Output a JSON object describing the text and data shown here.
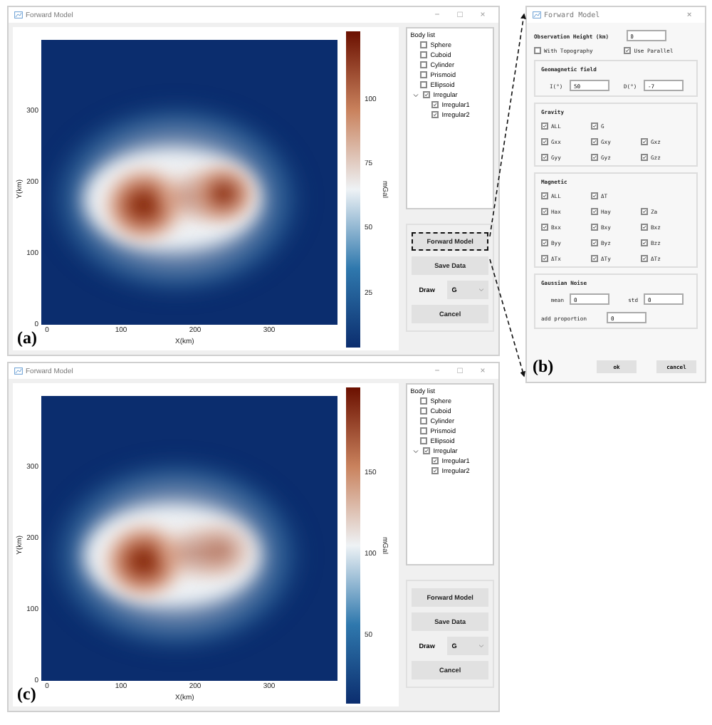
{
  "windows": [
    {
      "panel_label": "(a)",
      "title": "Forward Model",
      "controls": [
        "−",
        "□",
        "×"
      ],
      "plot": {
        "yticks": [
          "300",
          "200",
          "100",
          "0"
        ],
        "xticks": [
          "0",
          "100",
          "200",
          "300"
        ],
        "xlabel": "X(km)",
        "ylabel": "Y(km)",
        "colorbar_ticks": [
          "100",
          "75",
          "50",
          "25"
        ],
        "colorbar_label": "mGal"
      },
      "body_list": {
        "title": "Body list",
        "items": [
          {
            "label": "Sphere",
            "checked": false
          },
          {
            "label": "Cuboid",
            "checked": false
          },
          {
            "label": "Cylinder",
            "checked": false
          },
          {
            "label": "Prismoid",
            "checked": false
          },
          {
            "label": "Ellipsoid",
            "checked": false
          },
          {
            "label": "Irregular",
            "checked": true,
            "expanded": true,
            "children": [
              {
                "label": "Irregular1",
                "checked": true
              },
              {
                "label": "Irregular2",
                "checked": true
              }
            ]
          }
        ]
      },
      "buttons": [
        {
          "label": "Forward Model",
          "highlighted": true
        },
        {
          "label": "Save Data",
          "highlighted": false
        }
      ],
      "draw": {
        "label": "Draw",
        "value": "G"
      },
      "cancel": "Cancel"
    },
    {
      "panel_label": "(c)",
      "title": "Forward Model",
      "controls": [
        "−",
        "□",
        "×"
      ],
      "plot": {
        "yticks": [
          "300",
          "200",
          "100",
          "0"
        ],
        "xticks": [
          "0",
          "100",
          "200",
          "300"
        ],
        "xlabel": "X(km)",
        "ylabel": "Y(km)",
        "colorbar_ticks": [
          "150",
          "100",
          "50"
        ],
        "colorbar_label": "mGal"
      },
      "body_list": {
        "title": "Body list",
        "items": [
          {
            "label": "Sphere",
            "checked": false
          },
          {
            "label": "Cuboid",
            "checked": false
          },
          {
            "label": "Cylinder",
            "checked": false
          },
          {
            "label": "Prismoid",
            "checked": false
          },
          {
            "label": "Ellipsoid",
            "checked": false
          },
          {
            "label": "Irregular",
            "checked": true,
            "expanded": true,
            "children": [
              {
                "label": "Irregular1",
                "checked": true
              },
              {
                "label": "Irregular2",
                "checked": true
              }
            ]
          }
        ]
      },
      "buttons": [
        {
          "label": "Forward Model",
          "highlighted": false
        },
        {
          "label": "Save Data",
          "highlighted": false
        }
      ],
      "draw": {
        "label": "Draw",
        "value": "G"
      },
      "cancel": "Cancel"
    }
  ],
  "dialog": {
    "panel_label": "(b)",
    "title": "Forward Model",
    "close": "×",
    "height": {
      "label": "Observation Height (km)",
      "value": "0"
    },
    "options": [
      {
        "label": "With Topography",
        "checked": false
      },
      {
        "label": "Use Parallel",
        "checked": true
      }
    ],
    "geomagnetic": {
      "title": "Geomagnetic field",
      "fields": [
        {
          "label": "I(°)",
          "value": "50"
        },
        {
          "label": "D(°)",
          "value": "-7"
        }
      ]
    },
    "groups": [
      {
        "title": "Gravity",
        "rows": [
          [
            {
              "label": "ALL",
              "checked": true
            },
            {
              "label": "G",
              "checked": true
            }
          ],
          [
            {
              "label": "Gxx",
              "checked": true
            },
            {
              "label": "Gxy",
              "checked": true
            },
            {
              "label": "Gxz",
              "checked": true
            }
          ],
          [
            {
              "label": "Gyy",
              "checked": true
            },
            {
              "label": "Gyz",
              "checked": true
            },
            {
              "label": "Gzz",
              "checked": true
            }
          ]
        ]
      },
      {
        "title": "Magnetic",
        "rows": [
          [
            {
              "label": "ALL",
              "checked": true
            },
            {
              "label": "ΔT",
              "checked": true
            }
          ],
          [
            {
              "label": "Hax",
              "checked": true
            },
            {
              "label": "Hay",
              "checked": true
            },
            {
              "label": "Za",
              "checked": true
            }
          ],
          [
            {
              "label": "Bxx",
              "checked": true
            },
            {
              "label": "Bxy",
              "checked": true
            },
            {
              "label": "Bxz",
              "checked": true
            }
          ],
          [
            {
              "label": "Byy",
              "checked": true
            },
            {
              "label": "Byz",
              "checked": true
            },
            {
              "label": "Bzz",
              "checked": true
            }
          ],
          [
            {
              "label": "ΔTx",
              "checked": true
            },
            {
              "label": "ΔTy",
              "checked": true
            },
            {
              "label": "ΔTz",
              "checked": true
            }
          ]
        ]
      }
    ],
    "noise": {
      "title": "Gaussian Noise",
      "fields": [
        {
          "label": "mean",
          "value": "0"
        },
        {
          "label": "std",
          "value": "0"
        }
      ],
      "proportion": {
        "label": "add proportion",
        "value": "0"
      }
    },
    "buttons": [
      "ok",
      "cancel"
    ]
  }
}
